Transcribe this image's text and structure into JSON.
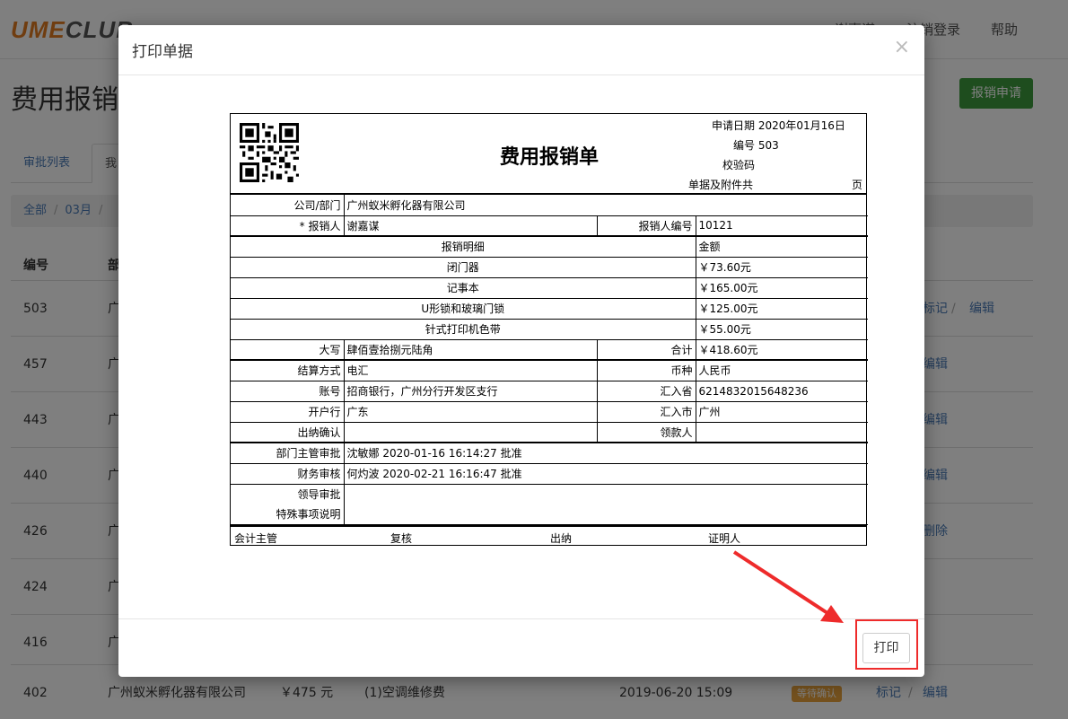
{
  "nav": {
    "logo_part1": "UME",
    "logo_part2": "CLUB",
    "items": [
      "谢嘉谋",
      "注销登录",
      "帮助"
    ]
  },
  "page": {
    "title": "费用报销",
    "apply_button": "报销申请",
    "tabs": [
      "审批列表",
      "我"
    ],
    "breadcrumb": [
      "全部",
      "03月",
      ""
    ],
    "columns": [
      "编号",
      "部"
    ]
  },
  "rows": [
    {
      "id": "503",
      "dept": "广",
      "actions": [
        "标记",
        "编辑"
      ]
    },
    {
      "id": "457",
      "dept": "广",
      "actions": [
        "编辑"
      ]
    },
    {
      "id": "443",
      "dept": "广",
      "actions": [
        "编辑"
      ]
    },
    {
      "id": "440",
      "dept": "广",
      "actions": [
        "编辑"
      ]
    },
    {
      "id": "426",
      "dept": "广",
      "actions": [
        "删除"
      ]
    },
    {
      "id": "424",
      "dept": "广",
      "actions": []
    },
    {
      "id": "416",
      "dept": "广",
      "actions": []
    },
    {
      "id": "402",
      "dept": "广州蚁米孵化器有限公司",
      "amount": "￥475 元",
      "desc": "(1)空调维修费",
      "date": "2019-06-20 15:09",
      "status": "等待确认",
      "actions": [
        "标记",
        "编辑"
      ]
    }
  ],
  "modal": {
    "title": "打印单据",
    "close_icon": "×",
    "print_button": "打印"
  },
  "receipt": {
    "title": "费用报销单",
    "apply_date": "申请日期 2020年01月16日",
    "number": "编号 503",
    "check_code": "校验码",
    "attachments": "单据及附件共",
    "pages_suffix": "页",
    "company_label": "公司/部门",
    "company": "广州蚁米孵化器有限公司",
    "applicant_label": "* 报销人",
    "applicant": "谢嘉谋",
    "applicant_no_label": "报销人编号",
    "applicant_no": "10121",
    "detail_header": "报销明细",
    "amount_header": "金额",
    "items": [
      {
        "name": "闭门器",
        "amount": "￥73.60元"
      },
      {
        "name": "记事本",
        "amount": "￥165.00元"
      },
      {
        "name": "U形锁和玻璃门锁",
        "amount": "￥125.00元"
      },
      {
        "name": "针式打印机色带",
        "amount": "￥55.00元"
      }
    ],
    "capital_label": "大写",
    "capital": "肆佰壹拾捌元陆角",
    "total_label": "合计",
    "total": "￥418.60元",
    "settle_label": "结算方式",
    "settle": "电汇",
    "currency_label": "币种",
    "currency": "人民币",
    "account_label": "账号",
    "account": "招商银行，广州分行开发区支行",
    "remit_prov_label": "汇入省",
    "remit_prov": "6214832015648236",
    "bank_label": "开户行",
    "bank": "广东",
    "remit_city_label": "汇入市",
    "remit_city": "广州",
    "cashier_confirm_label": "出纳确认",
    "payee_label": "领款人",
    "dept_approve_label": "部门主管审批",
    "dept_approve": "沈敏娜 2020-01-16 16:14:27 批准",
    "finance_label": "财务审核",
    "finance": "何灼波 2020-02-21 16:16:47 批准",
    "leader_label": "领导审批",
    "special_label": "特殊事项说明",
    "footer": [
      "会计主管",
      "复核",
      "出纳",
      "证明人"
    ]
  },
  "colors": {
    "accent_green": "#3c9b3c",
    "link_blue": "#4a7bb7",
    "highlight_red": "#ee2b2b",
    "badge_orange": "#e8a33d"
  }
}
